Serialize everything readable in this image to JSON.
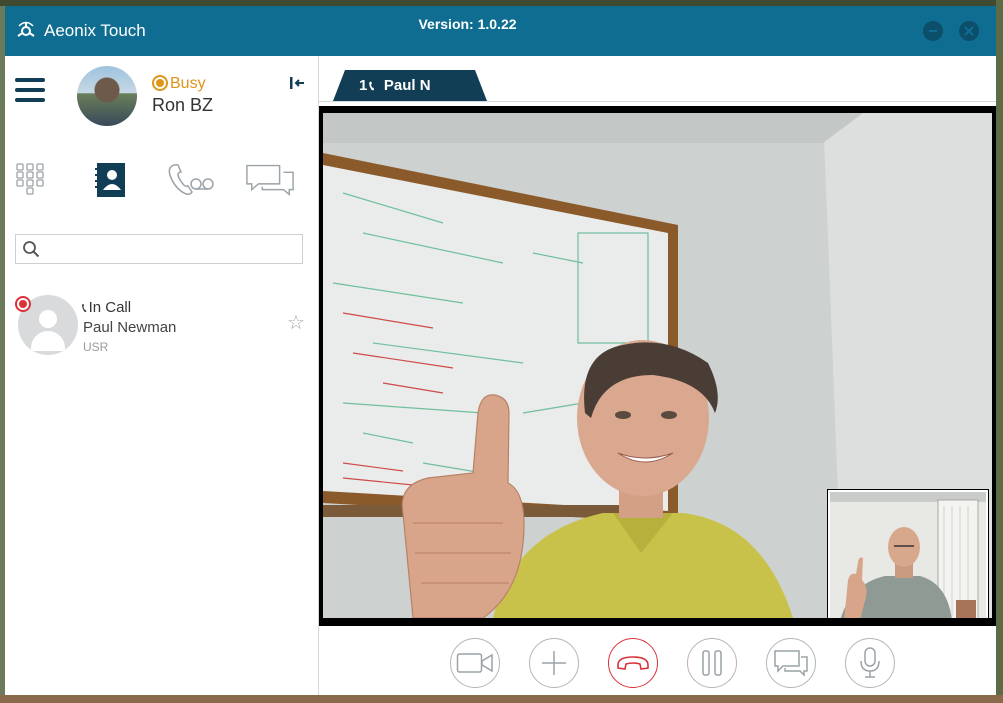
{
  "window": {
    "app_name": "Aeonix Touch",
    "version": "Version: 1.0.22",
    "accent_color": "#0e6d91"
  },
  "user": {
    "name": "Ron BZ",
    "status": "Busy",
    "status_color": "#e0941a"
  },
  "nav": {
    "items": [
      {
        "name": "keypad",
        "icon": "dialpad-icon"
      },
      {
        "name": "contacts",
        "icon": "contacts-icon",
        "active": true
      },
      {
        "name": "voicemail",
        "icon": "voicemail-icon"
      },
      {
        "name": "chat",
        "icon": "chat-icon"
      }
    ]
  },
  "search": {
    "placeholder": "",
    "value": ""
  },
  "contacts": [
    {
      "status": "In Call",
      "name": "Paul Newman",
      "type": "USR",
      "presence_color": "#d9333a"
    }
  ],
  "call_tab": {
    "number": "1",
    "name": "Paul N"
  },
  "controls": [
    {
      "name": "video-toggle",
      "icon": "video-camera-icon"
    },
    {
      "name": "add-call",
      "icon": "plus-icon"
    },
    {
      "name": "end-call",
      "icon": "hangup-icon",
      "color": "#d9333a"
    },
    {
      "name": "hold",
      "icon": "pause-icon"
    },
    {
      "name": "chat",
      "icon": "chat-bubble-icon"
    },
    {
      "name": "mute",
      "icon": "microphone-icon"
    }
  ]
}
